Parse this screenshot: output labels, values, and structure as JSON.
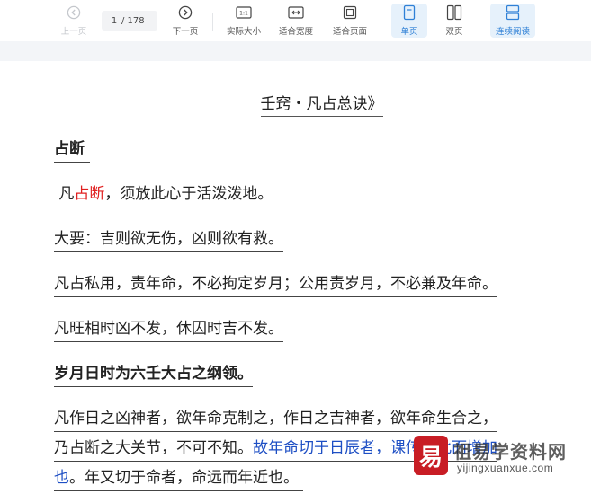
{
  "toolbar": {
    "prev_label": "上一页",
    "next_label": "下一页",
    "page_current": "1",
    "page_total": "/ 178",
    "actual_size_label": "实际大小",
    "actual_size_glyph": "1:1",
    "fit_width_label": "适合宽度",
    "fit_page_label": "适合页面",
    "single_page_label": "单页",
    "double_page_label": "双页",
    "continuous_label": "连续阅读",
    "accent_color": "#2f80d6"
  },
  "document": {
    "title": "壬窍・凡占总诀》",
    "heading": "占断",
    "p1_a": "凡",
    "p1_red": "占断",
    "p1_b": "，须放此心于活泼泼地。",
    "p2": "大要：吉则欲无伤，凶则欲有救。",
    "p3": "凡占私用，责年命，不必拘定岁月；公用责岁月，不必兼及年命。",
    "p4": "凡旺相时凶不发，休囚时吉不发。",
    "p5": "岁月日时为六壬大占之纲领。",
    "p6_line1": "凡作日之凶神者，欲年命克制之，作日之吉神者，欲年命生合之，",
    "p6_line2_a": "乃占断之大关节，不可不知。",
    "p6_line2_blue": "故年命切于日辰者，课传因此而增加",
    "p6_line3_blue": "也",
    "p6_line3_b": "。年又切于命者，命远而年近也。"
  },
  "watermark": {
    "logo_char": "易",
    "text_cn": "祖易学资料网",
    "text_en": "yijingxuanxue.com",
    "logo_color": "#c81d25"
  }
}
